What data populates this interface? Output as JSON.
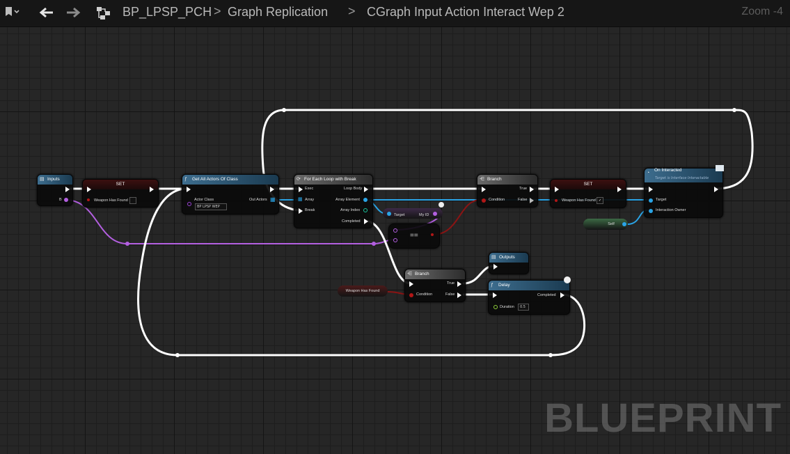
{
  "toolbar": {
    "breadcrumb_1": "BP_LPSP_PCH",
    "breadcrumb_2": "Graph Replication",
    "breadcrumb_3": "CGraph Input Action Interact Wep 2",
    "separator": ">",
    "zoom": "Zoom -4",
    "bookmark_icon": "bookmark-icon",
    "back_icon": "arrow-left-icon",
    "forward_icon": "arrow-right-icon",
    "graph_icon": "graph-hierarchy-icon"
  },
  "nodes": {
    "inputs": {
      "title": "Inputs",
      "pin_b": "B"
    },
    "set1": {
      "title": "SET",
      "pin_var": "Weapon Has Found"
    },
    "get_all_actors": {
      "title": "Get All Actors Of Class",
      "actor_class": "Actor Class",
      "class_value": "BP LPSP WEP",
      "out_actors": "Out Actors"
    },
    "for_each": {
      "title": "For Each Loop with Break",
      "exec": "Exec",
      "array": "Array",
      "break": "Break",
      "loop_body": "Loop Body",
      "array_element": "Array Element",
      "array_index": "Array Index",
      "completed": "Completed"
    },
    "myid": {
      "target": "Target",
      "value": "My ID"
    },
    "equals": {
      "symbol": "=="
    },
    "branch1": {
      "title": "Branch",
      "condition": "Condition",
      "true": "True",
      "false": "False"
    },
    "set2": {
      "title": "SET",
      "pin_var": "Weapon Has Found"
    },
    "on_interacted": {
      "title": "On Interacted",
      "subtitle": "Target is Interface Interactable",
      "target": "Target",
      "owner": "Interaction Owner"
    },
    "self": {
      "label": "Self"
    },
    "outputs": {
      "title": "Outputs"
    },
    "branch2": {
      "title": "Branch",
      "condition": "Condition",
      "true": "True",
      "false": "False"
    },
    "weapon_has_found_getter": {
      "label": "Weapon Has Found"
    },
    "delay": {
      "title": "Delay",
      "duration": "Duration",
      "duration_value": "0.5",
      "completed": "Completed"
    }
  },
  "watermark": "BLUEPRINT",
  "colors": {
    "exec": "#ffffff",
    "bool": "#b11717",
    "object": "#2aa4e6",
    "int": "#19c8a0",
    "struct": "#b35fe0",
    "header_blue": "#3d6d8e"
  }
}
